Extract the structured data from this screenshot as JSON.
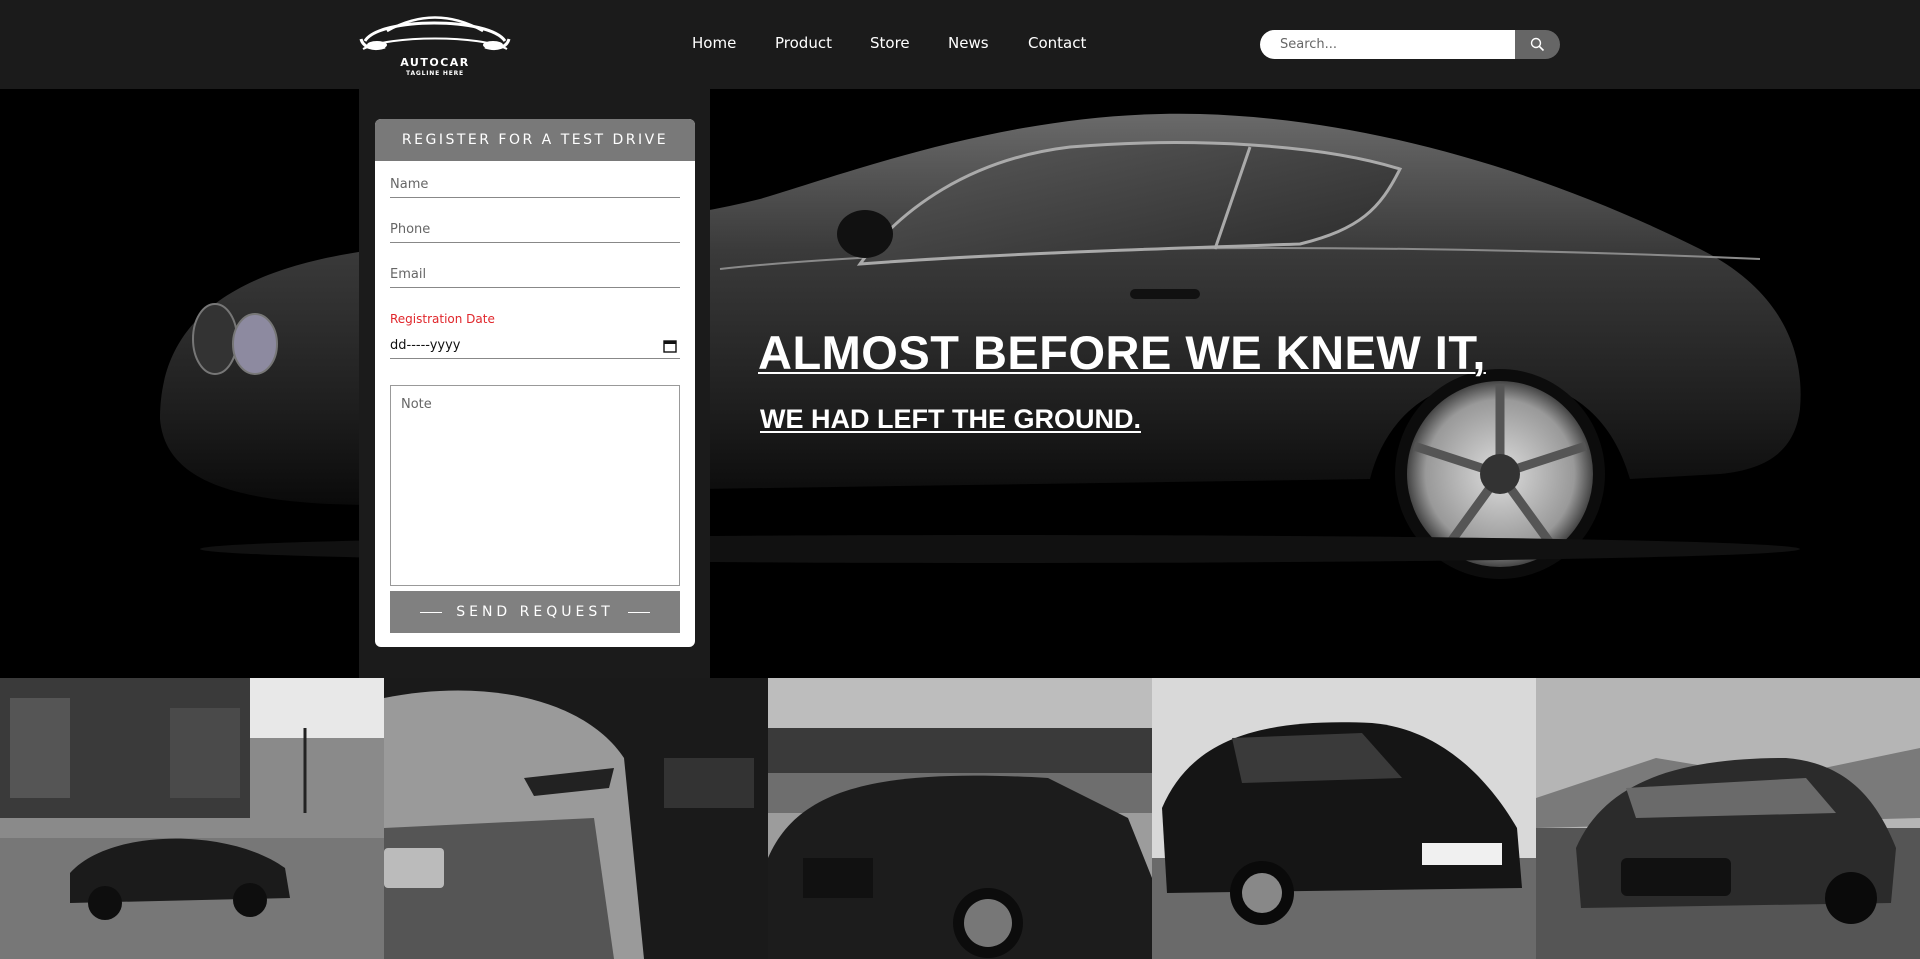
{
  "brand": {
    "name": "AUTOCAR",
    "tagline": "TAGLINE HERE"
  },
  "nav": {
    "items": [
      {
        "label": "Home"
      },
      {
        "label": "Product"
      },
      {
        "label": "Store"
      },
      {
        "label": "News"
      },
      {
        "label": "Contact"
      }
    ]
  },
  "search": {
    "placeholder": "Search...",
    "icon": "search-icon"
  },
  "form": {
    "title": "REGISTER FOR A TEST DRIVE",
    "name_placeholder": "Name",
    "phone_placeholder": "Phone",
    "email_placeholder": "Email",
    "date_label": "Registration Date",
    "date_value": "dd-----yyyy",
    "note_placeholder": "Note",
    "submit_label": "SEND REQUEST",
    "label_color": "#e0262b",
    "button_color": "#808080"
  },
  "hero": {
    "headline": "ALMOST BEFORE WE KNEW IT,",
    "subheadline": "WE HAD LEFT THE GROUND."
  },
  "gallery": {
    "tiles": [
      {
        "alt": "car-street-photo"
      },
      {
        "alt": "car-showroom-photo"
      },
      {
        "alt": "wagon-lake-photo"
      },
      {
        "alt": "hatchback-road-photo"
      },
      {
        "alt": "sedan-field-photo"
      }
    ]
  },
  "colors": {
    "header_bg": "#1b1b1b",
    "hero_bg": "#000000",
    "form_header_bg": "#797979"
  }
}
